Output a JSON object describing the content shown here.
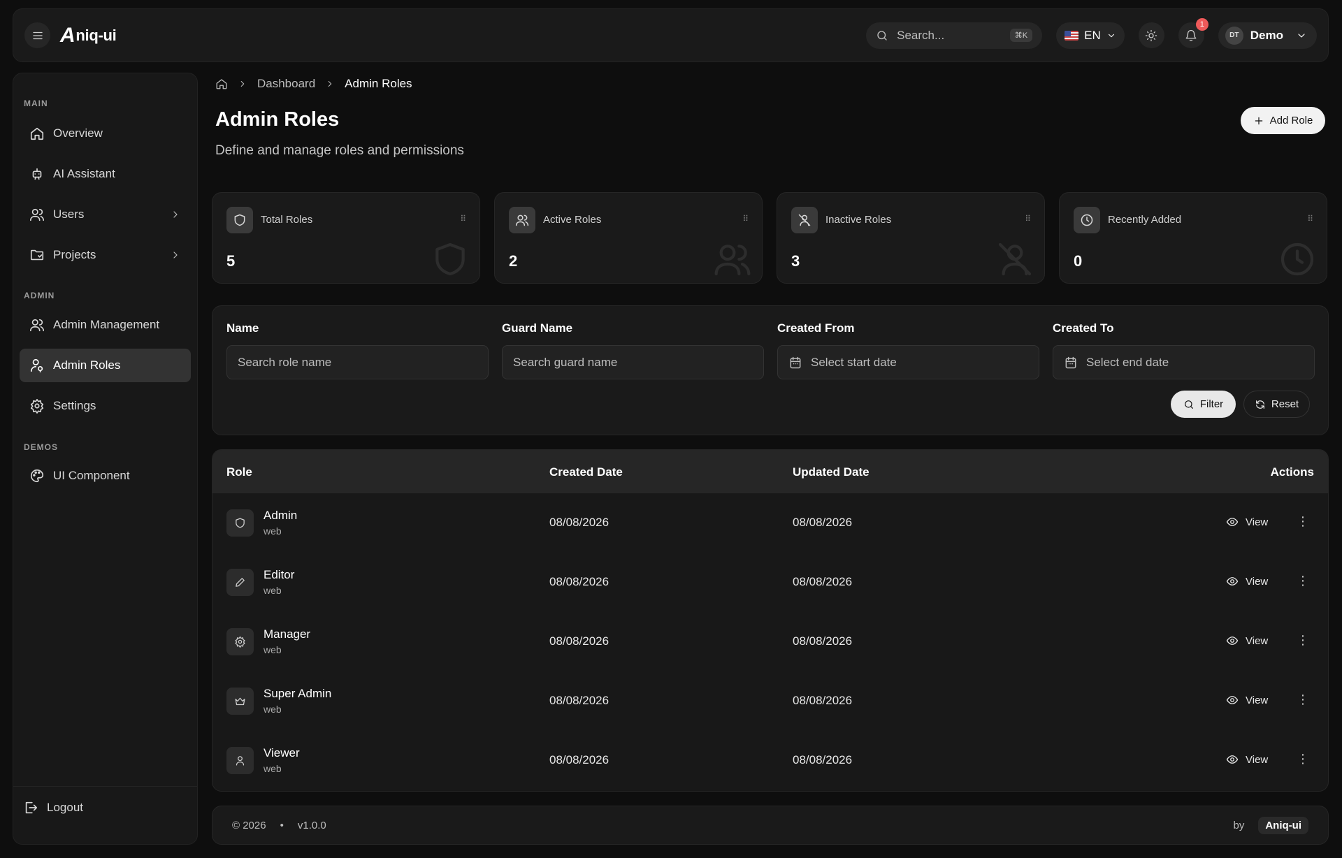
{
  "header": {
    "logo_mark": "A",
    "logo_text": "niq-ui",
    "search_placeholder": "Search...",
    "search_shortcut": "⌘K",
    "language": "EN",
    "notification_count": "1",
    "user_initials": "DT",
    "user_name": "Demo"
  },
  "sidebar": {
    "sections": {
      "main": "MAIN",
      "admin": "ADMIN",
      "demos": "DEMOS"
    },
    "items": [
      {
        "label": "Overview",
        "icon": "home-icon"
      },
      {
        "label": "AI Assistant",
        "icon": "robot-icon"
      },
      {
        "label": "Users",
        "icon": "users-icon"
      },
      {
        "label": "Projects",
        "icon": "folder-icon"
      },
      {
        "label": "Admin Management",
        "icon": "users-icon"
      },
      {
        "label": "Admin Roles",
        "icon": "user-key-icon",
        "active": true
      },
      {
        "label": "Settings",
        "icon": "gear-icon"
      },
      {
        "label": "UI Component",
        "icon": "palette-icon"
      }
    ],
    "logout_label": "Logout"
  },
  "breadcrumb": {
    "parent": "Dashboard",
    "current": "Admin Roles"
  },
  "page": {
    "title": "Admin Roles",
    "subtitle": "Define and manage roles and permissions",
    "add_button": "Add Role"
  },
  "stats": [
    {
      "label": "Total Roles",
      "value": "5",
      "icon": "shield-icon"
    },
    {
      "label": "Active Roles",
      "value": "2",
      "icon": "users-icon"
    },
    {
      "label": "Inactive Roles",
      "value": "3",
      "icon": "user-off-icon"
    },
    {
      "label": "Recently Added",
      "value": "0",
      "icon": "clock-icon"
    }
  ],
  "filters": {
    "name_label": "Name",
    "name_placeholder": "Search role name",
    "guard_label": "Guard Name",
    "guard_placeholder": "Search guard name",
    "from_label": "Created From",
    "from_placeholder": "Select start date",
    "to_label": "Created To",
    "to_placeholder": "Select end date",
    "filter_button": "Filter",
    "reset_button": "Reset"
  },
  "table": {
    "headers": {
      "role": "Role",
      "created": "Created Date",
      "updated": "Updated Date",
      "actions": "Actions"
    },
    "view_label": "View",
    "rows": [
      {
        "name": "Admin",
        "guard": "web",
        "created": "08/08/2026",
        "updated": "08/08/2026",
        "icon": "shield-icon"
      },
      {
        "name": "Editor",
        "guard": "web",
        "created": "08/08/2026",
        "updated": "08/08/2026",
        "icon": "pencil-icon"
      },
      {
        "name": "Manager",
        "guard": "web",
        "created": "08/08/2026",
        "updated": "08/08/2026",
        "icon": "gear-icon"
      },
      {
        "name": "Super Admin",
        "guard": "web",
        "created": "08/08/2026",
        "updated": "08/08/2026",
        "icon": "crown-icon"
      },
      {
        "name": "Viewer",
        "guard": "web",
        "created": "08/08/2026",
        "updated": "08/08/2026",
        "icon": "user-icon"
      }
    ]
  },
  "footer": {
    "copyright": "© 2026",
    "separator": "•",
    "version": "v1.0.0",
    "by": "by",
    "brand": "Aniq-ui"
  }
}
